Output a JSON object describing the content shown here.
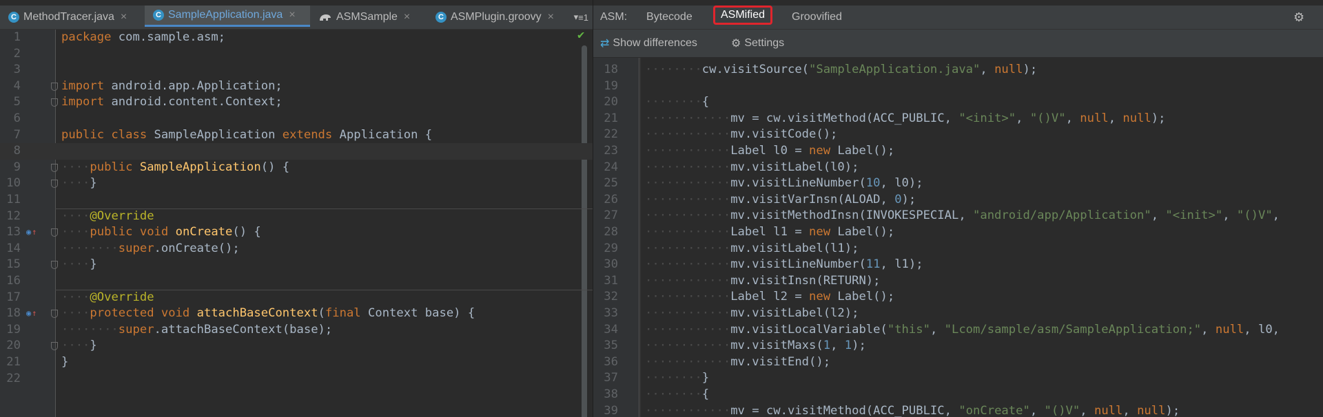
{
  "editor_tabs": [
    {
      "label": "MethodTracer.java",
      "icon": "java-class-icon",
      "glyph": "C",
      "active": false
    },
    {
      "label": "SampleApplication.java",
      "icon": "java-class-icon",
      "glyph": "C",
      "active": true
    },
    {
      "label": "ASMSample",
      "icon": "gradle-icon",
      "glyph": "",
      "active": false
    },
    {
      "label": "ASMPlugin.groovy",
      "icon": "groovy-class-icon",
      "glyph": "C",
      "active": false
    }
  ],
  "tabs_overflow": "≡1",
  "close_glyph": "×",
  "left_lines": [
    {
      "n": "1",
      "segs": [
        [
          "kw",
          "package "
        ],
        [
          "",
          "com.sample.asm;"
        ]
      ]
    },
    {
      "n": "2",
      "segs": []
    },
    {
      "n": "3",
      "segs": []
    },
    {
      "n": "4",
      "segs": [
        [
          "kw",
          "import "
        ],
        [
          "",
          "android.app.Application;"
        ]
      ]
    },
    {
      "n": "5",
      "segs": [
        [
          "kw",
          "import "
        ],
        [
          "",
          "android.content.Context;"
        ]
      ]
    },
    {
      "n": "6",
      "segs": []
    },
    {
      "n": "7",
      "segs": [
        [
          "kw",
          "public class "
        ],
        [
          "",
          "SampleApplication "
        ],
        [
          "kw",
          "extends "
        ],
        [
          "",
          "Application {"
        ]
      ]
    },
    {
      "n": "8",
      "segs": []
    },
    {
      "n": "9",
      "segs": [
        [
          "dot",
          "····"
        ],
        [
          "kw",
          "public "
        ],
        [
          "fn",
          "SampleApplication"
        ],
        [
          "",
          "() {"
        ]
      ]
    },
    {
      "n": "10",
      "segs": [
        [
          "dot",
          "····"
        ],
        [
          "",
          "}"
        ]
      ]
    },
    {
      "n": "11",
      "segs": []
    },
    {
      "n": "12",
      "segs": [
        [
          "dot",
          "····"
        ],
        [
          "ann",
          "@Override"
        ]
      ]
    },
    {
      "n": "13",
      "segs": [
        [
          "dot",
          "····"
        ],
        [
          "kw",
          "public void "
        ],
        [
          "fn",
          "onCreate"
        ],
        [
          "",
          "() {"
        ]
      ]
    },
    {
      "n": "14",
      "segs": [
        [
          "dot",
          "········"
        ],
        [
          "kw",
          "super"
        ],
        [
          "",
          "."
        ],
        [
          "",
          "onCreate();"
        ]
      ]
    },
    {
      "n": "15",
      "segs": [
        [
          "dot",
          "····"
        ],
        [
          "",
          "}"
        ]
      ]
    },
    {
      "n": "16",
      "segs": []
    },
    {
      "n": "17",
      "segs": [
        [
          "dot",
          "····"
        ],
        [
          "ann",
          "@Override"
        ]
      ]
    },
    {
      "n": "18",
      "segs": [
        [
          "dot",
          "····"
        ],
        [
          "kw",
          "protected void "
        ],
        [
          "fn",
          "attachBaseContext"
        ],
        [
          "",
          "("
        ],
        [
          "kw",
          "final "
        ],
        [
          "",
          "Context base) {"
        ]
      ]
    },
    {
      "n": "19",
      "segs": [
        [
          "dot",
          "········"
        ],
        [
          "kw",
          "super"
        ],
        [
          "",
          "."
        ],
        [
          "",
          "attachBaseContext(base);"
        ]
      ]
    },
    {
      "n": "20",
      "segs": [
        [
          "dot",
          "····"
        ],
        [
          "",
          "}"
        ]
      ]
    },
    {
      "n": "21",
      "segs": [
        [
          "",
          "}"
        ]
      ]
    },
    {
      "n": "22",
      "segs": []
    }
  ],
  "asm_panel": {
    "label": "ASM:",
    "tabs": [
      "Bytecode",
      "ASMified",
      "Groovified"
    ],
    "selected_tab": "ASMified",
    "show_differences": "Show differences",
    "settings": "Settings"
  },
  "right_lines": [
    {
      "n": "18",
      "segs": [
        [
          "dot",
          "········"
        ],
        [
          "",
          "cw.visitSource("
        ],
        [
          "str",
          "\"SampleApplication.java\""
        ],
        [
          "",
          " , "
        ],
        [
          "kw",
          "null"
        ],
        [
          "",
          ");"
        ]
      ]
    },
    {
      "n": "19",
      "segs": []
    },
    {
      "n": "20",
      "segs": [
        [
          "dot",
          "········"
        ],
        [
          "",
          "{"
        ]
      ]
    },
    {
      "n": "21",
      "segs": [
        [
          "dot",
          "············"
        ],
        [
          "",
          "mv = cw.visitMethod(ACC_PUBLIC, "
        ],
        [
          "str",
          "\"<init>\""
        ],
        [
          "",
          ", "
        ],
        [
          "str",
          "\"()V\""
        ],
        [
          "",
          ", "
        ],
        [
          "kw",
          "null"
        ],
        [
          "",
          ", "
        ],
        [
          "kw",
          "null"
        ],
        [
          "",
          ");"
        ]
      ]
    },
    {
      "n": "22",
      "segs": [
        [
          "dot",
          "············"
        ],
        [
          "",
          "mv.visitCode();"
        ]
      ]
    },
    {
      "n": "23",
      "segs": [
        [
          "dot",
          "············"
        ],
        [
          "",
          "Label l0 = "
        ],
        [
          "kw",
          "new "
        ],
        [
          "",
          "Label();"
        ]
      ]
    },
    {
      "n": "24",
      "segs": [
        [
          "dot",
          "············"
        ],
        [
          "",
          "mv.visitLabel(l0);"
        ]
      ]
    },
    {
      "n": "25",
      "segs": [
        [
          "dot",
          "············"
        ],
        [
          "",
          "mv.visitLineNumber("
        ],
        [
          "num",
          "10"
        ],
        [
          "",
          ", l0);"
        ]
      ]
    },
    {
      "n": "26",
      "segs": [
        [
          "dot",
          "············"
        ],
        [
          "",
          "mv.visitVarInsn(ALOAD, "
        ],
        [
          "num",
          "0"
        ],
        [
          "",
          ");"
        ]
      ]
    },
    {
      "n": "27",
      "segs": [
        [
          "dot",
          "············"
        ],
        [
          "",
          "mv.visitMethodInsn(INVOKESPECIAL, "
        ],
        [
          "str",
          "\"android/app/Application\""
        ],
        [
          "",
          ", "
        ],
        [
          "str",
          "\"<init>\""
        ],
        [
          "",
          ", "
        ],
        [
          "str",
          "\"()V\""
        ],
        [
          "",
          ","
        ]
      ]
    },
    {
      "n": "28",
      "segs": [
        [
          "dot",
          "············"
        ],
        [
          "",
          "Label l1 = "
        ],
        [
          "kw",
          "new "
        ],
        [
          "",
          "Label();"
        ]
      ]
    },
    {
      "n": "29",
      "segs": [
        [
          "dot",
          "············"
        ],
        [
          "",
          "mv.visitLabel(l1);"
        ]
      ]
    },
    {
      "n": "30",
      "segs": [
        [
          "dot",
          "············"
        ],
        [
          "",
          "mv.visitLineNumber("
        ],
        [
          "num",
          "11"
        ],
        [
          "",
          ", l1);"
        ]
      ]
    },
    {
      "n": "31",
      "segs": [
        [
          "dot",
          "············"
        ],
        [
          "",
          "mv.visitInsn(RETURN);"
        ]
      ]
    },
    {
      "n": "32",
      "segs": [
        [
          "dot",
          "············"
        ],
        [
          "",
          "Label l2 = "
        ],
        [
          "kw",
          "new "
        ],
        [
          "",
          "Label();"
        ]
      ]
    },
    {
      "n": "33",
      "segs": [
        [
          "dot",
          "············"
        ],
        [
          "",
          "mv.visitLabel(l2);"
        ]
      ]
    },
    {
      "n": "34",
      "segs": [
        [
          "dot",
          "············"
        ],
        [
          "",
          "mv.visitLocalVariable("
        ],
        [
          "str",
          "\"this\""
        ],
        [
          "",
          ", "
        ],
        [
          "str",
          "\"Lcom/sample/asm/SampleApplication;\""
        ],
        [
          "",
          ", "
        ],
        [
          "kw",
          "null"
        ],
        [
          "",
          ", l0,"
        ]
      ]
    },
    {
      "n": "35",
      "segs": [
        [
          "dot",
          "············"
        ],
        [
          "",
          "mv.visitMaxs("
        ],
        [
          "num",
          "1"
        ],
        [
          "",
          ", "
        ],
        [
          "num",
          "1"
        ],
        [
          "",
          ");"
        ]
      ]
    },
    {
      "n": "36",
      "segs": [
        [
          "dot",
          "············"
        ],
        [
          "",
          "mv.visitEnd();"
        ]
      ]
    },
    {
      "n": "37",
      "segs": [
        [
          "dot",
          "········"
        ],
        [
          "",
          "}"
        ]
      ]
    },
    {
      "n": "38",
      "segs": [
        [
          "dot",
          "········"
        ],
        [
          "",
          "{"
        ]
      ]
    },
    {
      "n": "39",
      "segs": [
        [
          "dot",
          "············"
        ],
        [
          "",
          "mv = cw.visitMethod(ACC_PUBLIC, "
        ],
        [
          "str",
          "\"onCreate\""
        ],
        [
          "",
          ", "
        ],
        [
          "str",
          "\"()V\""
        ],
        [
          "",
          ", "
        ],
        [
          "kw",
          "null"
        ],
        [
          "",
          ", "
        ],
        [
          "kw",
          "null"
        ],
        [
          "",
          ");"
        ]
      ]
    }
  ],
  "colors": {
    "keyword": "#cc7832",
    "string": "#6a8759",
    "number": "#6897bb",
    "annotation": "#bbb529",
    "method": "#ffc66d",
    "selected_outline": "#e0252d"
  }
}
